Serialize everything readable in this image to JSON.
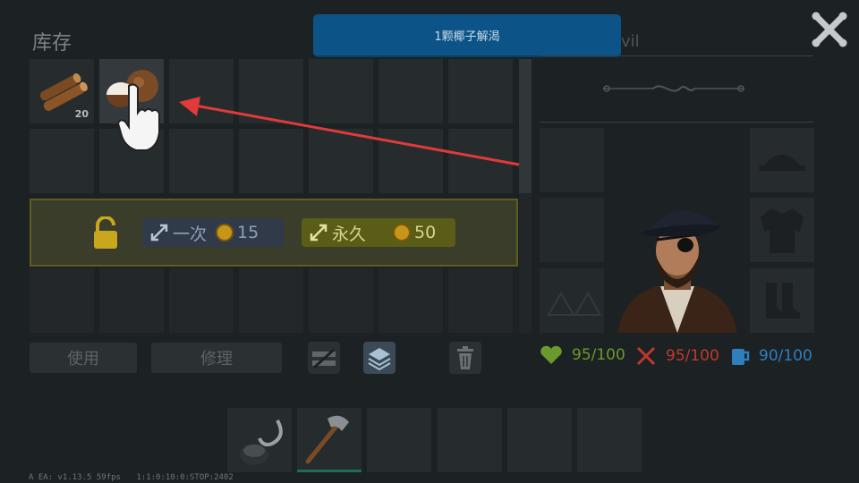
{
  "inventory": {
    "title": "库存",
    "wood_count": "20"
  },
  "tooltip": {
    "text": "1颗椰子解渴"
  },
  "character_panel": {
    "name_partial": "vil"
  },
  "unlock": {
    "once_label": "一次",
    "once_price": "15",
    "permanent_label": "永久",
    "permanent_price": "50"
  },
  "actions": {
    "use_label": "使用",
    "repair_label": "修理"
  },
  "stats": {
    "health": "95/100",
    "hunger": "95/100",
    "thirst": "90/100"
  },
  "colors": {
    "health": "#6b9a2c",
    "hunger": "#c0392b",
    "thirst": "#2f7fbf",
    "tooltip_bg": "#0c5487",
    "tutorial_arrow": "#e03a3a"
  },
  "footer": {
    "version": "A EA: v1.13.5  59fps",
    "debug": "1:1:0:10:0:STOP:2402"
  },
  "icons": [
    "wood-logs-icon",
    "coconut-icon",
    "tap-hand-icon",
    "close-icon",
    "padlock-icon",
    "expand-icon",
    "coin-icon",
    "drop-split-icon",
    "layers-icon",
    "trash-icon",
    "heart-icon",
    "cutlery-icon",
    "drink-icon",
    "hat-icon",
    "coat-icon",
    "boots-icon",
    "hook-icon",
    "stone-axe-icon"
  ]
}
